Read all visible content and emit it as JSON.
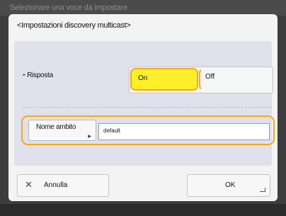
{
  "background": {
    "header_text": "Selezionare una voce da impostare"
  },
  "dialog": {
    "title": "<Impostazioni discovery multicast>",
    "response": {
      "label": "Risposta",
      "options": [
        "On",
        "Off"
      ],
      "selected": "On"
    },
    "scope": {
      "button_label": "Nome ambito",
      "value": "default"
    },
    "buttons": {
      "cancel": "Annulla",
      "ok": "OK"
    }
  },
  "colors": {
    "accent_ring": "#f5a81b",
    "selected_fill": "#ffef2b",
    "panel": "#dfe2ec",
    "bullet": "#2a55c8"
  },
  "icons": {
    "cancel": "close-icon",
    "ok_corner": "enter-corner-icon",
    "scope_button": "triangle-indicator-icon"
  }
}
